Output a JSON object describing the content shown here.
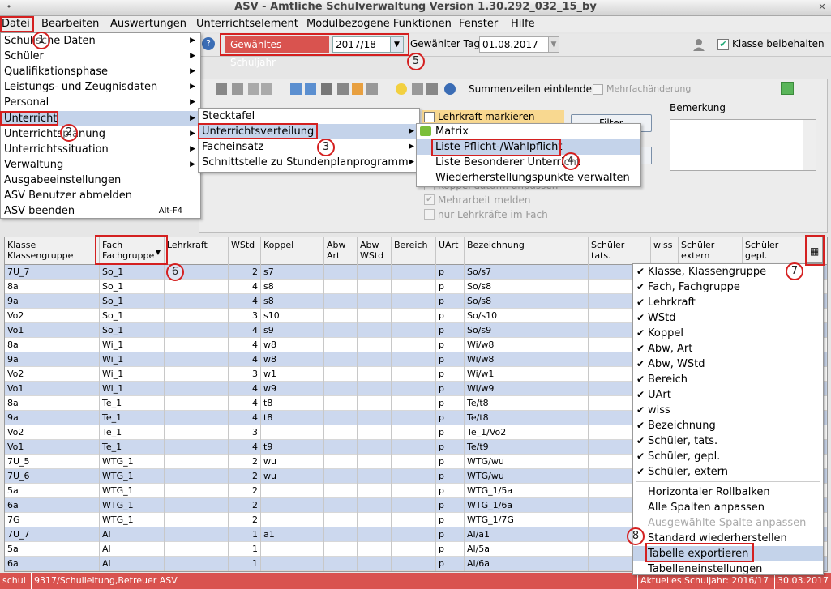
{
  "window": {
    "title": "ASV - Amtliche Schulverwaltung Version 1.30.292_032_15_by"
  },
  "menubar": [
    "Datei",
    "Bearbeiten",
    "Auswertungen",
    "Unterrichtselement",
    "Modulbezogene Funktionen",
    "Fenster",
    "Hilfe"
  ],
  "toolbar": {
    "schuljahr_label": "Gewähltes Schuljahr",
    "schuljahr_value": "2017/18",
    "tag_label": "Gewählter Tag",
    "tag_value": "01.08.2017",
    "klasse_beibehalten": "Klasse beibehalten"
  },
  "toolbar2": {
    "summenzeilen": "Summenzeilen einblenden",
    "mehrfach": "Mehrfachänderung"
  },
  "panel": {
    "bemerkung_label": "Bemerkung",
    "lehrkraft_markieren": "Lehrkraft markieren",
    "filter_label": "Filter",
    "options": [
      "Koppel datum. anpassen",
      "Mehrarbeit melden",
      "nur Lehrkräfte im Fach"
    ]
  },
  "datei_menu": [
    {
      "label": "Schulische Daten",
      "arrow": true
    },
    {
      "label": "Schüler",
      "arrow": true
    },
    {
      "label": "Qualifikationsphase",
      "arrow": true
    },
    {
      "label": "Leistungs- und Zeugnisdaten",
      "arrow": true
    },
    {
      "label": "Personal",
      "arrow": true
    },
    {
      "label": "Unterricht",
      "arrow": true
    },
    {
      "label": "Unterrichtsplanung",
      "arrow": true
    },
    {
      "label": "Unterrichtssituation",
      "arrow": true
    },
    {
      "label": "Verwaltung",
      "arrow": true
    },
    {
      "label": "Ausgabeeinstellungen",
      "arrow": false
    },
    {
      "label": "ASV Benutzer abmelden",
      "arrow": false
    },
    {
      "label": "ASV beenden",
      "arrow": false,
      "accel": "Alt-F4"
    }
  ],
  "unterricht_menu": [
    {
      "label": "Stecktafel",
      "arrow": false
    },
    {
      "label": "Unterrichtsverteilung",
      "arrow": true
    },
    {
      "label": "Facheinsatz",
      "arrow": true
    },
    {
      "label": "Schnittstelle zu Stundenplanprogramm",
      "arrow": true
    }
  ],
  "verteilung_menu": [
    "Matrix",
    "Liste Pflicht-/Wahlpflicht",
    "Liste Besonderer Unterricht",
    "Wiederherstellungspunkte verwalten"
  ],
  "table": {
    "headers": [
      {
        "label": "Klasse\nKlassengruppe"
      },
      {
        "label": "Fach\nFachgruppe"
      },
      {
        "label": "Lehrkraft"
      },
      {
        "label": "WStd"
      },
      {
        "label": "Koppel"
      },
      {
        "label": "Abw\nArt"
      },
      {
        "label": "Abw\nWStd"
      },
      {
        "label": "Bereich"
      },
      {
        "label": "UArt"
      },
      {
        "label": "Bezeichnung"
      },
      {
        "label": "Schüler\ntats."
      },
      {
        "label": "wiss"
      },
      {
        "label": "Schüler\nextern"
      },
      {
        "label": "Schüler\ngepl."
      }
    ],
    "rows": [
      [
        "7U_7",
        "So_1",
        "",
        "2",
        "s7",
        "",
        "",
        "",
        "p",
        "So/s7",
        "",
        "",
        "",
        ""
      ],
      [
        "8a",
        "So_1",
        "",
        "4",
        "s8",
        "",
        "",
        "",
        "p",
        "So/s8",
        "",
        "",
        "",
        ""
      ],
      [
        "9a",
        "So_1",
        "",
        "4",
        "s8",
        "",
        "",
        "",
        "p",
        "So/s8",
        "",
        "",
        "",
        ""
      ],
      [
        "Vo2",
        "So_1",
        "",
        "3",
        "s10",
        "",
        "",
        "",
        "p",
        "So/s10",
        "",
        "",
        "",
        ""
      ],
      [
        "Vo1",
        "So_1",
        "",
        "4",
        "s9",
        "",
        "",
        "",
        "p",
        "So/s9",
        "",
        "",
        "",
        ""
      ],
      [
        "8a",
        "Wi_1",
        "",
        "4",
        "w8",
        "",
        "",
        "",
        "p",
        "Wi/w8",
        "",
        "",
        "",
        ""
      ],
      [
        "9a",
        "Wi_1",
        "",
        "4",
        "w8",
        "",
        "",
        "",
        "p",
        "Wi/w8",
        "",
        "",
        "",
        ""
      ],
      [
        "Vo2",
        "Wi_1",
        "",
        "3",
        "w1",
        "",
        "",
        "",
        "p",
        "Wi/w1",
        "",
        "",
        "",
        ""
      ],
      [
        "Vo1",
        "Wi_1",
        "",
        "4",
        "w9",
        "",
        "",
        "",
        "p",
        "Wi/w9",
        "",
        "",
        "",
        ""
      ],
      [
        "8a",
        "Te_1",
        "",
        "4",
        "t8",
        "",
        "",
        "",
        "p",
        "Te/t8",
        "",
        "",
        "",
        ""
      ],
      [
        "9a",
        "Te_1",
        "",
        "4",
        "t8",
        "",
        "",
        "",
        "p",
        "Te/t8",
        "",
        "",
        "",
        ""
      ],
      [
        "Vo2",
        "Te_1",
        "",
        "3",
        "",
        "",
        "",
        "",
        "p",
        "Te_1/Vo2",
        "",
        "",
        "",
        ""
      ],
      [
        "Vo1",
        "Te_1",
        "",
        "4",
        "t9",
        "",
        "",
        "",
        "p",
        "Te/t9",
        "",
        "",
        "",
        ""
      ],
      [
        "7U_5",
        "WTG_1",
        "",
        "2",
        "wu",
        "",
        "",
        "",
        "p",
        "WTG/wu",
        "",
        "",
        "",
        ""
      ],
      [
        "7U_6",
        "WTG_1",
        "",
        "2",
        "wu",
        "",
        "",
        "",
        "p",
        "WTG/wu",
        "",
        "",
        "",
        ""
      ],
      [
        "5a",
        "WTG_1",
        "",
        "2",
        "",
        "",
        "",
        "",
        "p",
        "WTG_1/5a",
        "",
        "",
        "",
        ""
      ],
      [
        "6a",
        "WTG_1",
        "",
        "2",
        "",
        "",
        "",
        "",
        "p",
        "WTG_1/6a",
        "",
        "",
        "",
        ""
      ],
      [
        "7G",
        "WTG_1",
        "",
        "2",
        "",
        "",
        "",
        "",
        "p",
        "WTG_1/7G",
        "",
        "",
        "",
        ""
      ],
      [
        "7U_7",
        "Al",
        "",
        "1",
        "a1",
        "",
        "",
        "",
        "p",
        "Al/a1",
        "",
        "",
        "",
        ""
      ],
      [
        "5a",
        "Al",
        "",
        "1",
        "",
        "",
        "",
        "",
        "p",
        "Al/5a",
        "",
        "",
        "",
        ""
      ],
      [
        "6a",
        "Al",
        "",
        "1",
        "",
        "",
        "",
        "",
        "p",
        "Al/6a",
        "",
        "",
        "",
        ""
      ]
    ]
  },
  "column_menu": {
    "checked": [
      "Klasse, Klassengruppe",
      "Fach, Fachgruppe",
      "Lehrkraft",
      "WStd",
      "Koppel",
      "Abw, Art",
      "Abw, WStd",
      "Bereich",
      "UArt",
      "wiss",
      "Bezeichnung",
      "Schüler, tats.",
      "Schüler, gepl.",
      "Schüler, extern"
    ],
    "actions": [
      {
        "label": "Horizontaler Rollbalken",
        "disabled": false
      },
      {
        "label": "Alle Spalten anpassen",
        "disabled": false
      },
      {
        "label": "Ausgewählte Spalte anpassen",
        "disabled": true
      },
      {
        "label": "Standard wiederherstellen",
        "disabled": false
      },
      {
        "label": "Tabelle exportieren",
        "disabled": false
      },
      {
        "label": "Tabelleneinstellungen",
        "disabled": false
      }
    ]
  },
  "status": {
    "left1": "schul",
    "left2": "9317/Schulleitung,Betreuer ASV",
    "right1": "Aktuelles Schuljahr: 2016/17",
    "right2": "30.03.2017"
  },
  "annotations": [
    "1",
    "2",
    "3",
    "4",
    "5",
    "6",
    "7",
    "8"
  ],
  "colors": {
    "accent_red": "#d9534f",
    "annotation_red": "#d42020",
    "row_blue": "#ccd8ee",
    "menu_selection": "#c4d3ea"
  }
}
